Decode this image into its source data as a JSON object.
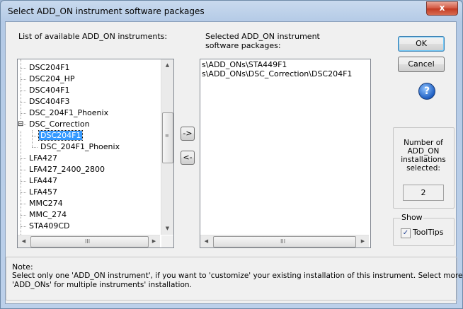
{
  "window": {
    "title": "Select ADD_ON instrument software packages",
    "close_label": "x"
  },
  "available": {
    "label": "List of available ADD_ON instruments:",
    "items": [
      {
        "label": "DSC204F1",
        "level": 1
      },
      {
        "label": "DSC204_HP",
        "level": 1
      },
      {
        "label": "DSC404F1",
        "level": 1
      },
      {
        "label": "DSC404F3",
        "level": 1
      },
      {
        "label": "DSC_204F1_Phoenix",
        "level": 1
      },
      {
        "label": "DSC_Correction",
        "level": 1,
        "expander": "⊟"
      },
      {
        "label": "DSC204F1",
        "level": 2,
        "selected": true
      },
      {
        "label": "DSC_204F1_Phoenix",
        "level": 2
      },
      {
        "label": "LFA427",
        "level": 1
      },
      {
        "label": "LFA427_2400_2800",
        "level": 1
      },
      {
        "label": "LFA447",
        "level": 1
      },
      {
        "label": "LFA457",
        "level": 1
      },
      {
        "label": "MMC274",
        "level": 1
      },
      {
        "label": "MMC_274",
        "level": 1
      },
      {
        "label": "STA409CD",
        "level": 1
      }
    ],
    "hscroll_grip": "III"
  },
  "selected": {
    "label_line1": "Selected ADD_ON instrument",
    "label_line2": "software packages:",
    "items": [
      "s\\ADD_ONs\\STA449F1",
      "s\\ADD_ONs\\DSC_Correction\\DSC204F1"
    ],
    "hscroll_grip": "III"
  },
  "buttons": {
    "add": "->",
    "remove": "<-",
    "ok": "OK",
    "cancel": "Cancel",
    "help": "?"
  },
  "count": {
    "label_lines": [
      "Number of",
      "ADD_ON",
      "installations",
      "selected:"
    ],
    "value": "2"
  },
  "show": {
    "label": "Show",
    "tooltips_label": "ToolTips",
    "tooltips_checked": true,
    "check_mark": "✓"
  },
  "note": {
    "heading": "Note:",
    "line1": "Select only one 'ADD_ON instrument', if you want to 'customize' your existing installation of this instrument. Select more",
    "line2": "'ADD_ONs' for multiple instruments' installation."
  }
}
